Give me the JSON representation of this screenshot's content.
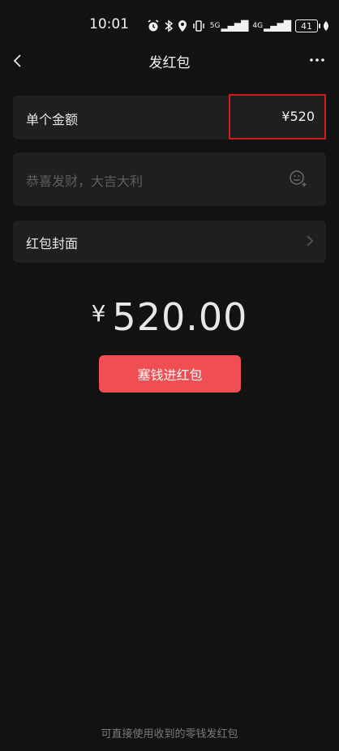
{
  "status_bar": {
    "time": "10:01",
    "network_5g": "5G",
    "network_4g": "4G",
    "battery": "41"
  },
  "nav": {
    "title": "发红包"
  },
  "amount_row": {
    "label": "单个金额",
    "value": "¥520"
  },
  "greeting": {
    "placeholder": "恭喜发财，大吉大利"
  },
  "cover_row": {
    "label": "红包封面"
  },
  "total": {
    "currency_symbol": "¥",
    "amount": "520.00"
  },
  "submit_button": {
    "label": "塞钱进红包"
  },
  "footer": {
    "note": "可直接使用收到的零钱发红包"
  },
  "colors": {
    "background": "#121212",
    "card": "#1f1f1f",
    "accent_button": "#f04e52",
    "highlight_border": "#d21b1b"
  },
  "icons": {
    "back": "chevron-left-icon",
    "more": "more-dots-icon",
    "emoji": "emoji-add-icon",
    "cover_arrow": "chevron-right-icon"
  }
}
